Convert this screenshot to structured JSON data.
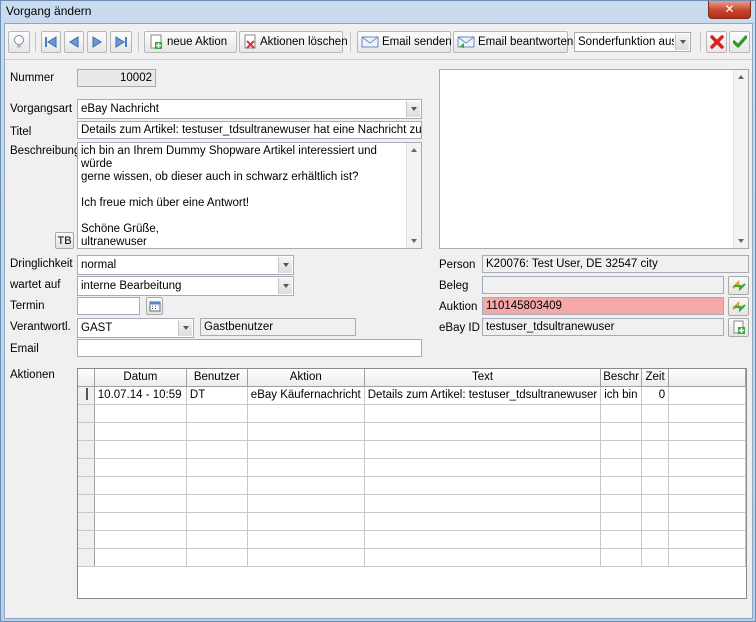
{
  "window": {
    "title": "Vorgang ändern",
    "close_glyph": "✕"
  },
  "toolbar": {
    "new_action": "neue Aktion",
    "delete_actions": "Aktionen löschen",
    "send_email": "Email senden",
    "reply_email": "Email beantworten",
    "special_function": "Sonderfunktion ausw"
  },
  "form": {
    "nummer_label": "Nummer",
    "nummer_value": "10002",
    "vorgangsart_label": "Vorgangsart",
    "vorgangsart_value": "eBay Nachricht",
    "titel_label": "Titel",
    "titel_value": "Details zum Artikel: testuser_tdsultranewuser hat eine Nachricht zu Shop",
    "beschreibung_label": "Beschreibung",
    "beschreibung_lines": [
      "ich bin an Ihrem Dummy Shopware Artikel interessiert und würde",
      "gerne wissen, ob dieser auch in schwarz erhältlich ist?",
      "",
      "Ich freue mich über eine Antwort!",
      "",
      "Schöne Grüße,",
      "ultranewuser"
    ],
    "tb_button": "TB",
    "dringlichkeit_label": "Dringlichkeit",
    "dringlichkeit_value": "normal",
    "wartet_label": "wartet auf",
    "wartet_value": "interne Bearbeitung",
    "termin_label": "Termin",
    "termin_value": "",
    "verantwortl_label": "Verantwortl.",
    "verantwortl_value": "GAST",
    "verantwortl_name": "Gastbenutzer",
    "email_label": "Email",
    "email_value": "",
    "person_label": "Person",
    "person_value": "K20076: Test User, DE 32547 city",
    "beleg_label": "Beleg",
    "beleg_value": "",
    "auktion_label": "Auktion",
    "auktion_value": "110145803409",
    "ebayid_label": "eBay ID",
    "ebayid_value": "testuser_tdsultranewuser"
  },
  "actions": {
    "label": "Aktionen",
    "columns": [
      "Datum",
      "Benutzer",
      "Aktion",
      "Text",
      "Beschr",
      "Zeit"
    ],
    "rows": [
      [
        "10.07.14 - 10:59",
        "DT",
        "eBay Käufernachricht",
        "Details zum Artikel: testuser_tdsultranewuser",
        "ich bin",
        "0"
      ]
    ]
  },
  "colors": {
    "auktion_highlight": "#f4a8a8",
    "close_red": "#c8442c"
  }
}
